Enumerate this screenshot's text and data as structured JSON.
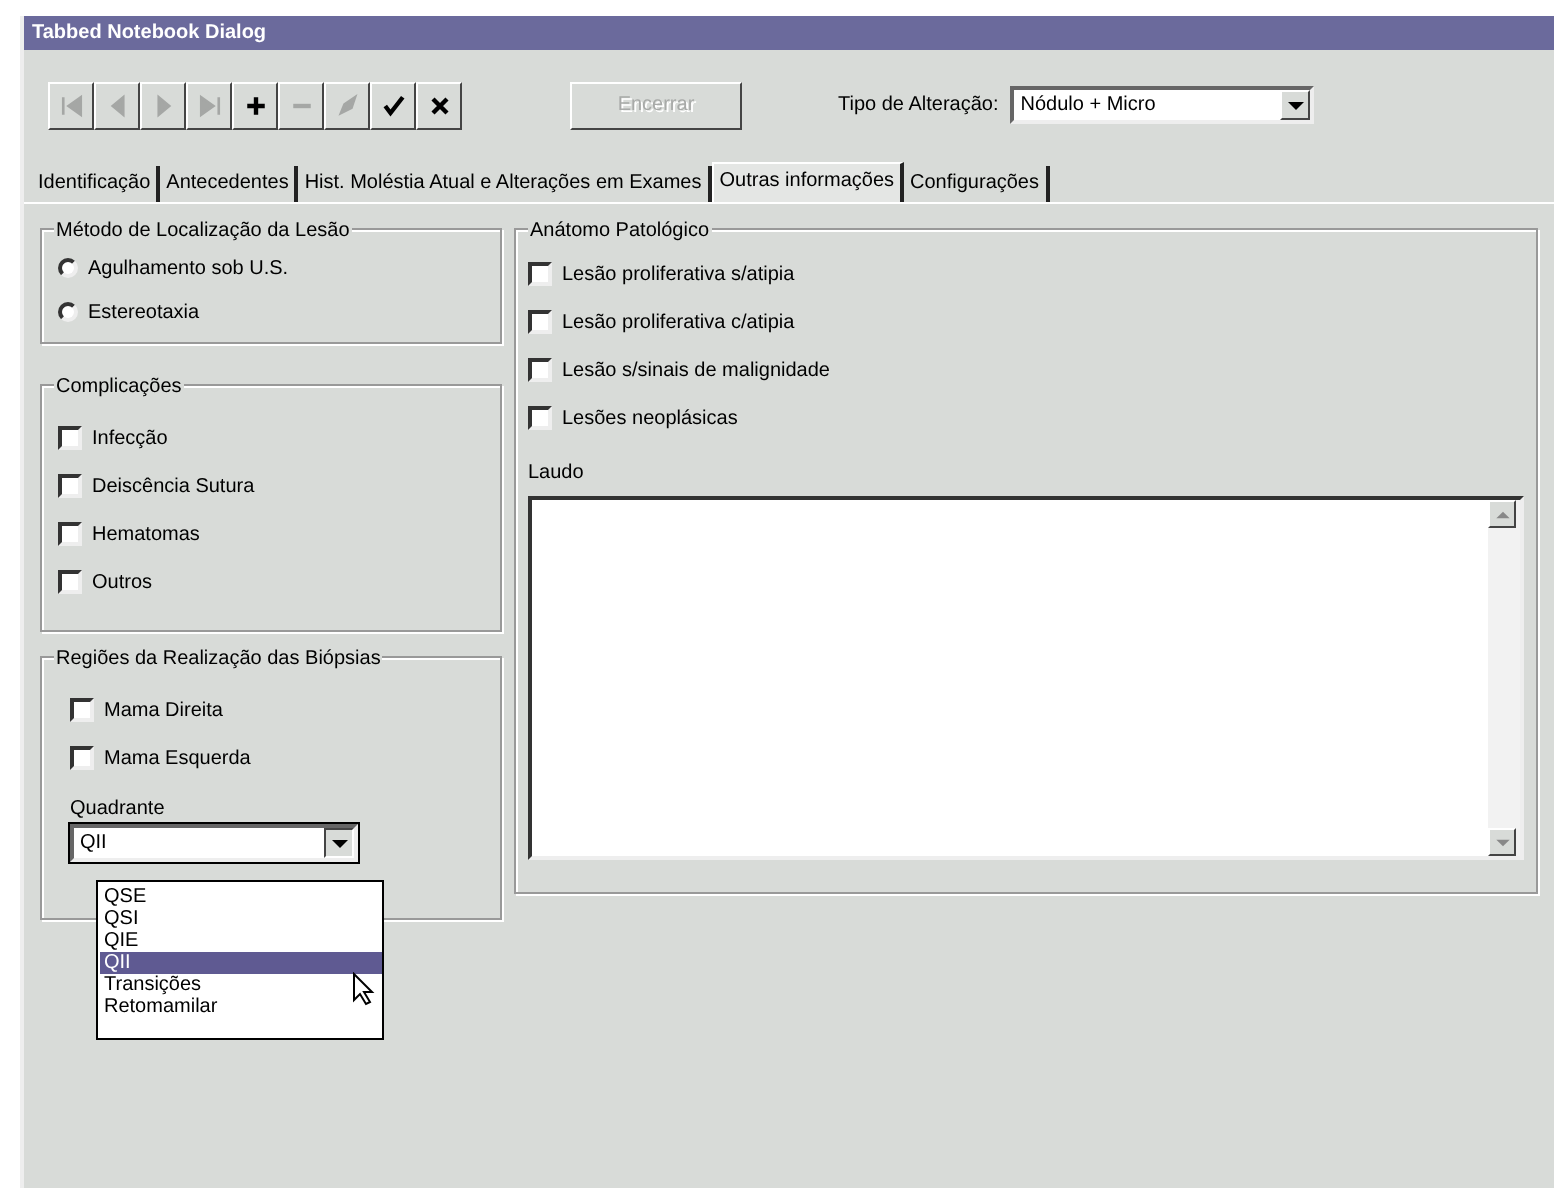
{
  "window": {
    "title": "Tabbed Notebook Dialog"
  },
  "toolbar": {
    "buttons": [
      {
        "kind": "first",
        "disabled": true
      },
      {
        "kind": "prev",
        "disabled": true
      },
      {
        "kind": "next",
        "disabled": true
      },
      {
        "kind": "last",
        "disabled": true
      },
      {
        "kind": "add",
        "disabled": false
      },
      {
        "kind": "remove",
        "disabled": true
      },
      {
        "kind": "edit",
        "disabled": true
      },
      {
        "kind": "confirm",
        "disabled": false
      },
      {
        "kind": "cancel",
        "disabled": false
      }
    ],
    "action_button": {
      "label": "Encerrar",
      "disabled": true
    },
    "change_type": {
      "label": "Tipo de Alteração:",
      "value": "Nódulo + Micro"
    }
  },
  "tabs": [
    {
      "label": "Identificação",
      "selected": false
    },
    {
      "label": "Antecedentes",
      "selected": false
    },
    {
      "label": "Hist. Moléstia Atual e Alterações em Exames",
      "selected": false
    },
    {
      "label": "Outras informações",
      "selected": true
    },
    {
      "label": "Configurações",
      "selected": false
    }
  ],
  "localization_method": {
    "title": "Método de Localização da Lesão",
    "options": [
      {
        "label": "Agulhamento sob U.S.",
        "selected": false
      },
      {
        "label": "Estereotaxia",
        "selected": false
      }
    ]
  },
  "complications": {
    "title": "Complicações",
    "items": [
      {
        "label": "Infecção",
        "checked": false
      },
      {
        "label": "Deiscência Sutura",
        "checked": false
      },
      {
        "label": "Hematomas",
        "checked": false
      },
      {
        "label": "Outros",
        "checked": false
      }
    ]
  },
  "biopsy_regions": {
    "title": "Regiões da Realização das Biópsias",
    "items": [
      {
        "label": "Mama Direita",
        "checked": false
      },
      {
        "label": "Mama Esquerda",
        "checked": false
      }
    ],
    "quadrant": {
      "label": "Quadrante",
      "value": "QII",
      "open": true,
      "options": [
        {
          "label": "QSE",
          "selected": false
        },
        {
          "label": "QSI",
          "selected": false
        },
        {
          "label": "QIE",
          "selected": false
        },
        {
          "label": "QII",
          "selected": true
        },
        {
          "label": "Transições",
          "selected": false
        },
        {
          "label": "Retomamilar",
          "selected": false
        }
      ]
    }
  },
  "pathology": {
    "title": "Anátomo Patológico",
    "items": [
      {
        "label": "Lesão proliferativa s/atipia",
        "checked": false
      },
      {
        "label": "Lesão proliferativa c/atipia",
        "checked": false
      },
      {
        "label": "Lesão s/sinais de malignidade",
        "checked": false
      },
      {
        "label": "Lesões neoplásicas",
        "checked": false
      }
    ]
  },
  "report": {
    "label": "Laudo"
  }
}
